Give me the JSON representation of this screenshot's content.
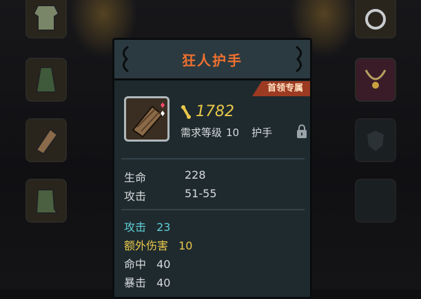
{
  "item": {
    "name": "狂人护手",
    "badge": "首领专属",
    "price": "1782",
    "requirement_label": "需求等级",
    "requirement_level": "10",
    "slot_type": "护手",
    "locked": true
  },
  "base_stats": [
    {
      "label": "生命",
      "value": "228"
    },
    {
      "label": "攻击",
      "value": "51-55"
    }
  ],
  "bonus_stats": [
    {
      "label": "攻击",
      "value": "23",
      "color": "#5ed0d8"
    },
    {
      "label": "额外伤害",
      "value": "10",
      "color": "#e8c84a"
    },
    {
      "label": "命中",
      "value": "40",
      "color": "#d6dadc"
    },
    {
      "label": "暴击",
      "value": "40",
      "color": "#d6dadc"
    }
  ],
  "colors": {
    "title": "#f07030",
    "price": "#e8c84a",
    "badge_bg": "#9c3a22"
  },
  "icons": {
    "price": "bone-currency-icon",
    "lock": "lock-icon",
    "item": "gauntlet-icon"
  }
}
